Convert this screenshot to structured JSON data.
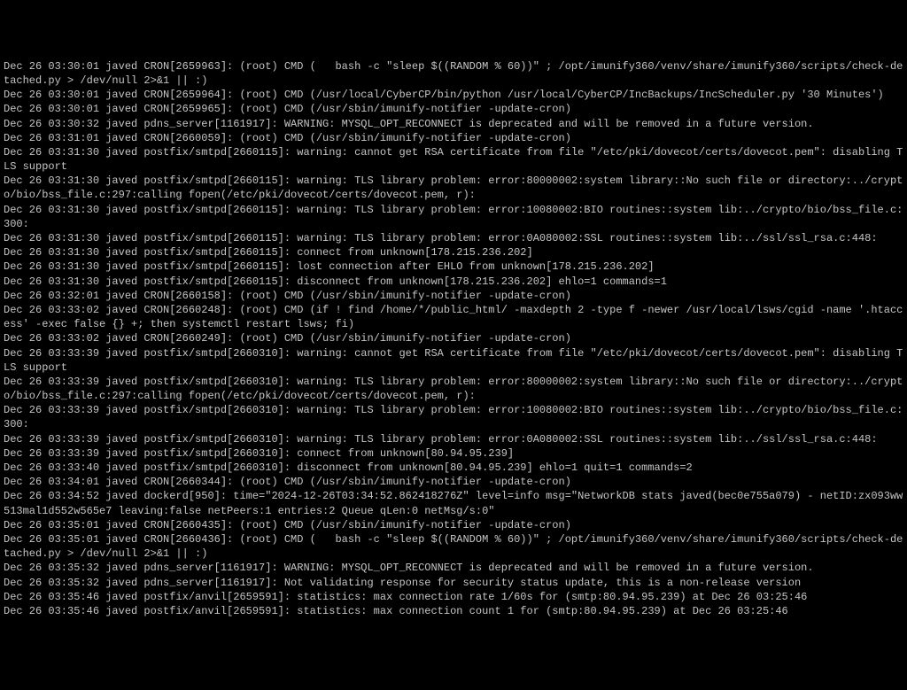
{
  "log_lines": [
    "Dec 26 03:30:01 javed CRON[2659963]: (root) CMD (   bash -c \"sleep $((RANDOM % 60))\" ; /opt/imunify360/venv/share/imunify360/scripts/check-detached.py > /dev/null 2>&1 || :)",
    "Dec 26 03:30:01 javed CRON[2659964]: (root) CMD (/usr/local/CyberCP/bin/python /usr/local/CyberCP/IncBackups/IncScheduler.py '30 Minutes')",
    "Dec 26 03:30:01 javed CRON[2659965]: (root) CMD (/usr/sbin/imunify-notifier -update-cron)",
    "Dec 26 03:30:32 javed pdns_server[1161917]: WARNING: MYSQL_OPT_RECONNECT is deprecated and will be removed in a future version.",
    "Dec 26 03:31:01 javed CRON[2660059]: (root) CMD (/usr/sbin/imunify-notifier -update-cron)",
    "Dec 26 03:31:30 javed postfix/smtpd[2660115]: warning: cannot get RSA certificate from file \"/etc/pki/dovecot/certs/dovecot.pem\": disabling TLS support",
    "Dec 26 03:31:30 javed postfix/smtpd[2660115]: warning: TLS library problem: error:80000002:system library::No such file or directory:../crypto/bio/bss_file.c:297:calling fopen(/etc/pki/dovecot/certs/dovecot.pem, r):",
    "Dec 26 03:31:30 javed postfix/smtpd[2660115]: warning: TLS library problem: error:10080002:BIO routines::system lib:../crypto/bio/bss_file.c:300:",
    "Dec 26 03:31:30 javed postfix/smtpd[2660115]: warning: TLS library problem: error:0A080002:SSL routines::system lib:../ssl/ssl_rsa.c:448:",
    "Dec 26 03:31:30 javed postfix/smtpd[2660115]: connect from unknown[178.215.236.202]",
    "Dec 26 03:31:30 javed postfix/smtpd[2660115]: lost connection after EHLO from unknown[178.215.236.202]",
    "Dec 26 03:31:30 javed postfix/smtpd[2660115]: disconnect from unknown[178.215.236.202] ehlo=1 commands=1",
    "Dec 26 03:32:01 javed CRON[2660158]: (root) CMD (/usr/sbin/imunify-notifier -update-cron)",
    "Dec 26 03:33:02 javed CRON[2660248]: (root) CMD (if ! find /home/*/public_html/ -maxdepth 2 -type f -newer /usr/local/lsws/cgid -name '.htaccess' -exec false {} +; then systemctl restart lsws; fi)",
    "Dec 26 03:33:02 javed CRON[2660249]: (root) CMD (/usr/sbin/imunify-notifier -update-cron)",
    "Dec 26 03:33:39 javed postfix/smtpd[2660310]: warning: cannot get RSA certificate from file \"/etc/pki/dovecot/certs/dovecot.pem\": disabling TLS support",
    "Dec 26 03:33:39 javed postfix/smtpd[2660310]: warning: TLS library problem: error:80000002:system library::No such file or directory:../crypto/bio/bss_file.c:297:calling fopen(/etc/pki/dovecot/certs/dovecot.pem, r):",
    "Dec 26 03:33:39 javed postfix/smtpd[2660310]: warning: TLS library problem: error:10080002:BIO routines::system lib:../crypto/bio/bss_file.c:300:",
    "Dec 26 03:33:39 javed postfix/smtpd[2660310]: warning: TLS library problem: error:0A080002:SSL routines::system lib:../ssl/ssl_rsa.c:448:",
    "Dec 26 03:33:39 javed postfix/smtpd[2660310]: connect from unknown[80.94.95.239]",
    "Dec 26 03:33:40 javed postfix/smtpd[2660310]: disconnect from unknown[80.94.95.239] ehlo=1 quit=1 commands=2",
    "Dec 26 03:34:01 javed CRON[2660344]: (root) CMD (/usr/sbin/imunify-notifier -update-cron)",
    "Dec 26 03:34:52 javed dockerd[950]: time=\"2024-12-26T03:34:52.862418276Z\" level=info msg=\"NetworkDB stats javed(bec0e755a079) - netID:zx093ww513mal1d552w565e7 leaving:false netPeers:1 entries:2 Queue qLen:0 netMsg/s:0\"",
    "Dec 26 03:35:01 javed CRON[2660435]: (root) CMD (/usr/sbin/imunify-notifier -update-cron)",
    "Dec 26 03:35:01 javed CRON[2660436]: (root) CMD (   bash -c \"sleep $((RANDOM % 60))\" ; /opt/imunify360/venv/share/imunify360/scripts/check-detached.py > /dev/null 2>&1 || :)",
    "Dec 26 03:35:32 javed pdns_server[1161917]: WARNING: MYSQL_OPT_RECONNECT is deprecated and will be removed in a future version.",
    "Dec 26 03:35:32 javed pdns_server[1161917]: Not validating response for security status update, this is a non-release version",
    "Dec 26 03:35:46 javed postfix/anvil[2659591]: statistics: max connection rate 1/60s for (smtp:80.94.95.239) at Dec 26 03:25:46",
    "Dec 26 03:35:46 javed postfix/anvil[2659591]: statistics: max connection count 1 for (smtp:80.94.95.239) at Dec 26 03:25:46"
  ]
}
